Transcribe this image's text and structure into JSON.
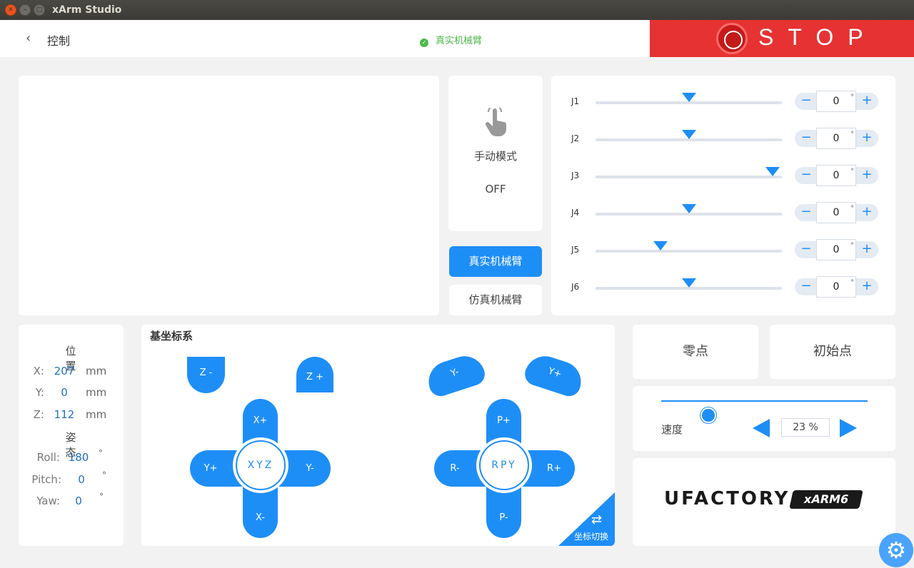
{
  "window": {
    "title": "xArm Studio"
  },
  "header": {
    "back_glyph": "‹",
    "title": "控制",
    "status": "真实机械臂",
    "stop_label": "STOP"
  },
  "mode": {
    "label": "手动模式",
    "value": "OFF"
  },
  "arm_select": {
    "real": "真实机械臂",
    "sim": "仿真机械臂"
  },
  "joints": [
    {
      "name": "J1",
      "value": "0",
      "unit": "°",
      "position": 0.5
    },
    {
      "name": "J2",
      "value": "0",
      "unit": "°",
      "position": 0.5
    },
    {
      "name": "J3",
      "value": "0",
      "unit": "°",
      "position": 0.95
    },
    {
      "name": "J4",
      "value": "0",
      "unit": "°",
      "position": 0.5
    },
    {
      "name": "J5",
      "value": "0",
      "unit": "°",
      "position": 0.35
    },
    {
      "name": "J6",
      "value": "0",
      "unit": "°",
      "position": 0.5
    }
  ],
  "position": {
    "title": "位置",
    "x": {
      "label": "X:",
      "value": "207",
      "unit": "mm"
    },
    "y": {
      "label": "Y:",
      "value": "0",
      "unit": "mm"
    },
    "z": {
      "label": "Z:",
      "value": "112",
      "unit": "mm"
    }
  },
  "attitude": {
    "title": "姿态",
    "roll": {
      "label": "Roll:",
      "value": "180",
      "unit": "°"
    },
    "pitch": {
      "label": "Pitch:",
      "value": "0",
      "unit": "°"
    },
    "yaw": {
      "label": "Yaw:",
      "value": "0",
      "unit": "°"
    }
  },
  "coord": {
    "title": "基坐标系",
    "z_minus": "Z -",
    "z_plus": "Z +",
    "x_plus": "X+",
    "x_minus": "X-",
    "y_plus": "Y+",
    "y_minus": "Y-",
    "xyz": "XYZ",
    "yaw_minus": "Y-",
    "yaw_plus": "Y+",
    "p_plus": "P+",
    "p_minus": "P-",
    "r_minus": "R-",
    "r_plus": "R+",
    "rpy": "RPY",
    "switch": "坐标切换"
  },
  "zero_button": "零点",
  "home_button": "初始点",
  "speed": {
    "label": "速度",
    "value": "23 %",
    "percent": 23
  },
  "brand": {
    "logo": "UFACTORY",
    "model": "xARM6"
  }
}
